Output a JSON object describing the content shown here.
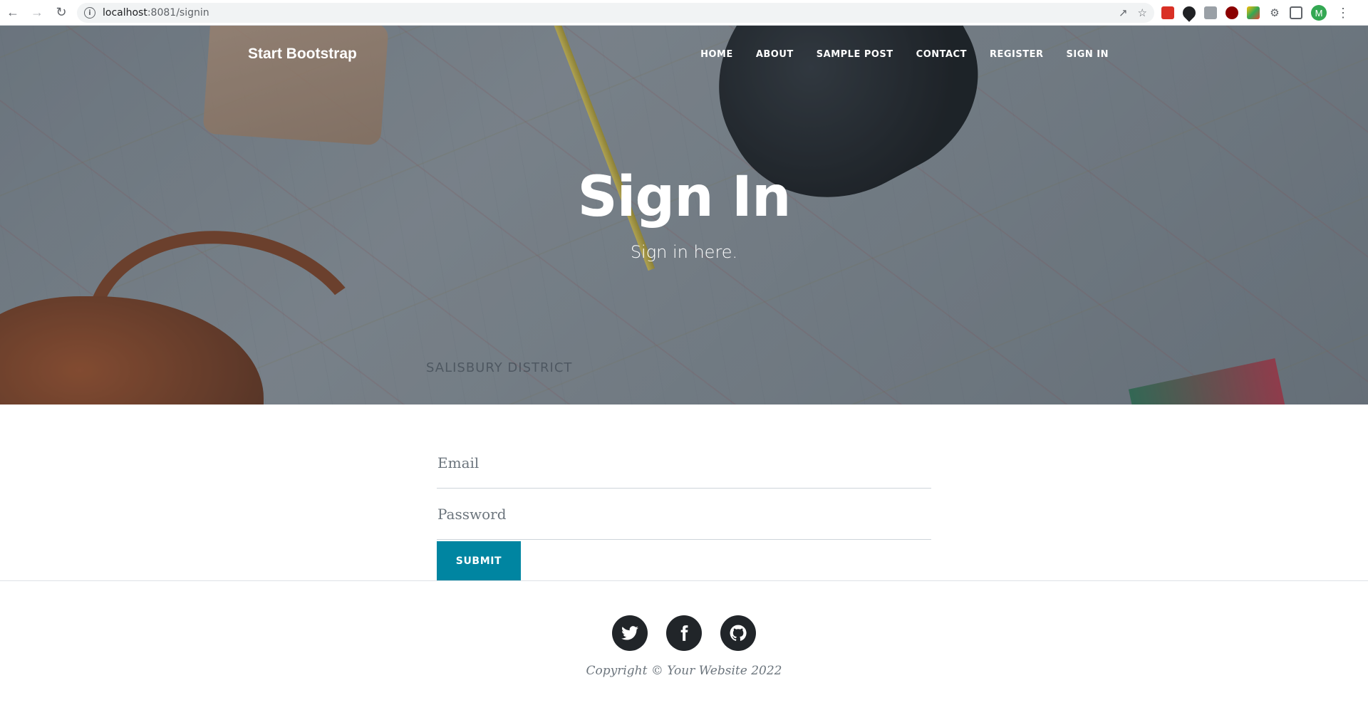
{
  "browser": {
    "url_host": "localhost",
    "url_port_path": ":8081/signin",
    "avatar_letter": "M"
  },
  "nav": {
    "brand": "Start Bootstrap",
    "links": [
      "HOME",
      "ABOUT",
      "SAMPLE POST",
      "CONTACT",
      "REGISTER",
      "SIGN IN"
    ]
  },
  "hero": {
    "heading": "Sign In",
    "subheading": "Sign in here.",
    "map_label": "SALISBURY DISTRICT"
  },
  "form": {
    "email_placeholder": "Email",
    "password_placeholder": "Password",
    "submit_label": "SUBMIT"
  },
  "footer": {
    "social_icons": [
      "twitter-icon",
      "facebook-icon",
      "github-icon"
    ],
    "copyright": "Copyright © Your Website 2022"
  },
  "colors": {
    "primary": "#0085a1",
    "social_bg": "#212529",
    "muted_text": "#6c757d"
  }
}
